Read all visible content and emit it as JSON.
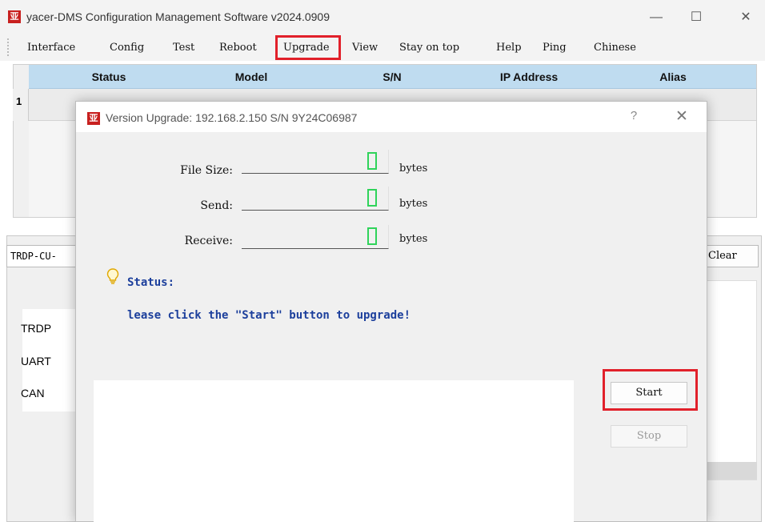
{
  "main_window": {
    "title": "yacer-DMS Configuration Management Software v2024.0909",
    "logo_text": "亚",
    "controls": {
      "minimize": "—",
      "maximize": "☐",
      "close": "✕"
    }
  },
  "menu": {
    "items": [
      "Interface",
      "Config",
      "Test",
      "Reboot",
      "Upgrade",
      "View",
      "Stay on top",
      "Help",
      "Ping",
      "Chinese"
    ],
    "highlighted": "Upgrade"
  },
  "device_table": {
    "columns": [
      "Status",
      "Model",
      "S/N",
      "IP Address",
      "Alias"
    ],
    "rows": [
      {
        "index": "1"
      }
    ]
  },
  "bottom_panel": {
    "device_combo": "TRDP-CU-",
    "clear_button": "Clear",
    "interfaces": [
      "TRDP",
      "UART",
      "CAN"
    ]
  },
  "upgrade_dialog": {
    "logo_text": "亚",
    "title": "Version Upgrade: 192.168.2.150  S/N 9Y24C06987",
    "help_icon": "?",
    "close_icon": "✕",
    "fields": [
      {
        "label": "File Size:",
        "value": 0,
        "unit": "bytes"
      },
      {
        "label": "Send:",
        "value": 0,
        "unit": "bytes"
      },
      {
        "label": "Receive:",
        "value": 0,
        "unit": "bytes"
      }
    ],
    "status_label": "Status:",
    "status_message": "lease click the \"Start\" button to upgrade!",
    "start_button": "Start",
    "stop_button": "Stop",
    "highlighted": "Start"
  },
  "colors": {
    "highlight_box": "#e1202a",
    "table_header": "#bfdcf0",
    "status_text": "#1c3f9c",
    "lcd_digit": "#2fd35a",
    "logo": "#c8201f"
  }
}
